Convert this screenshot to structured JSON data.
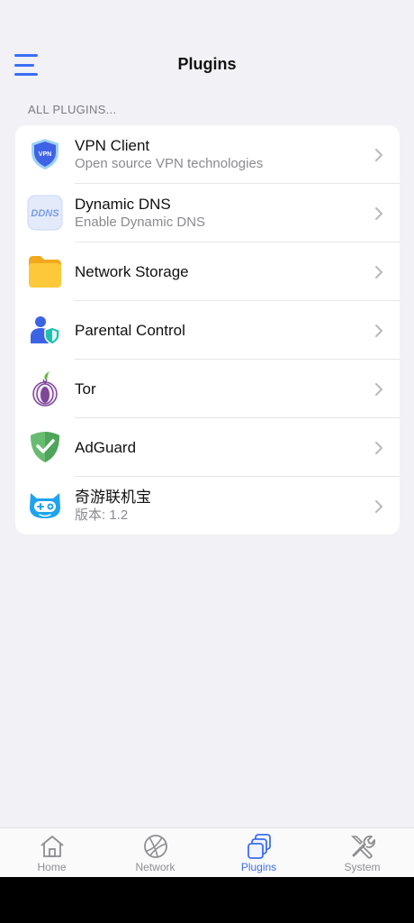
{
  "header": {
    "title": "Plugins"
  },
  "section_label": "ALL PLUGINS...",
  "plugins": [
    {
      "title": "VPN Client",
      "subtitle": "Open source VPN technologies",
      "icon": "vpn-shield-icon",
      "badge": "VPN"
    },
    {
      "title": "Dynamic DNS",
      "subtitle": "Enable Dynamic DNS",
      "icon": "ddns-icon",
      "badge": "DDNS"
    },
    {
      "title": "Network Storage",
      "subtitle": "",
      "icon": "folder-icon"
    },
    {
      "title": "Parental Control",
      "subtitle": "",
      "icon": "parental-control-icon"
    },
    {
      "title": "Tor",
      "subtitle": "",
      "icon": "tor-onion-icon"
    },
    {
      "title": "AdGuard",
      "subtitle": "",
      "icon": "adguard-shield-icon"
    },
    {
      "title": "奇游联机宝",
      "subtitle": "版本: 1.2",
      "icon": "qiyou-gamepad-icon"
    }
  ],
  "tabs": [
    {
      "label": "Home",
      "icon": "home-icon",
      "active": false
    },
    {
      "label": "Network",
      "icon": "globe-icon",
      "active": false
    },
    {
      "label": "Plugins",
      "icon": "plugins-icon",
      "active": true
    },
    {
      "label": "System",
      "icon": "tools-icon",
      "active": false
    }
  ],
  "colors": {
    "accent": "#3b6ef5",
    "background": "#f1f1f6",
    "card": "#ffffff"
  }
}
